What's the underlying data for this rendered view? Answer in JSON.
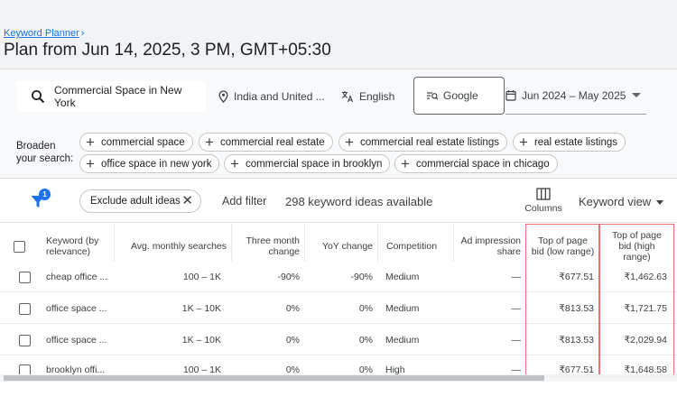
{
  "breadcrumb": {
    "label": "Keyword Planner",
    "chevron": "›"
  },
  "page_title": "Plan from Jun 14, 2025, 3 PM, GMT+05:30",
  "filters": {
    "seed_keyword": "Commercial Space in New York",
    "location": "India and United ...",
    "language": "English",
    "network": "Google",
    "date_range": "Jun 2024 – May 2025"
  },
  "broaden": {
    "label": "Broaden your search:",
    "chips": [
      "commercial space",
      "commercial real estate",
      "commercial real estate listings",
      "real estate listings",
      "office space in new york",
      "commercial space in brooklyn",
      "commercial space in chicago"
    ]
  },
  "toolbar": {
    "filter_badge": "1",
    "exclude_chip": "Exclude adult ideas",
    "exclude_close": "✕",
    "add_filter": "Add filter",
    "ideas_count": "298 keyword ideas available",
    "columns_label": "Columns",
    "keyword_view": "Keyword view"
  },
  "table": {
    "headers": {
      "keyword": "Keyword (by relevance)",
      "avg_searches": "Avg. monthly searches",
      "three_month": "Three month change",
      "yoy": "YoY change",
      "competition": "Competition",
      "ad_share": "Ad impression share",
      "bid_low": "Top of page bid (low range)",
      "bid_high": "Top of page bid (high range)"
    },
    "rows": [
      {
        "keyword": "cheap office ...",
        "avg": "100 – 1K",
        "three": "-90%",
        "yoy": "-90%",
        "comp": "Medium",
        "share": "—",
        "low": "₹677.51",
        "high": "₹1,462.63"
      },
      {
        "keyword": "office space ...",
        "avg": "1K – 10K",
        "three": "0%",
        "yoy": "0%",
        "comp": "Medium",
        "share": "—",
        "low": "₹813.53",
        "high": "₹1,721.75"
      },
      {
        "keyword": "office space ...",
        "avg": "1K – 10K",
        "three": "0%",
        "yoy": "0%",
        "comp": "Medium",
        "share": "—",
        "low": "₹813.53",
        "high": "₹2,029.94"
      },
      {
        "keyword": "brooklyn offi...",
        "avg": "100 – 1K",
        "three": "0%",
        "yoy": "0%",
        "comp": "High",
        "share": "—",
        "low": "₹677.51",
        "high": "₹1,648.58"
      }
    ]
  },
  "colors": {
    "accent": "#1a73e8",
    "highlight_border": "#e57373",
    "header_bg": "#f1f3f4"
  },
  "icons": [
    "search-icon",
    "location-pin-icon",
    "translate-icon",
    "network-icon",
    "calendar-icon",
    "filter-icon",
    "columns-icon",
    "close-icon",
    "plus-icon"
  ]
}
